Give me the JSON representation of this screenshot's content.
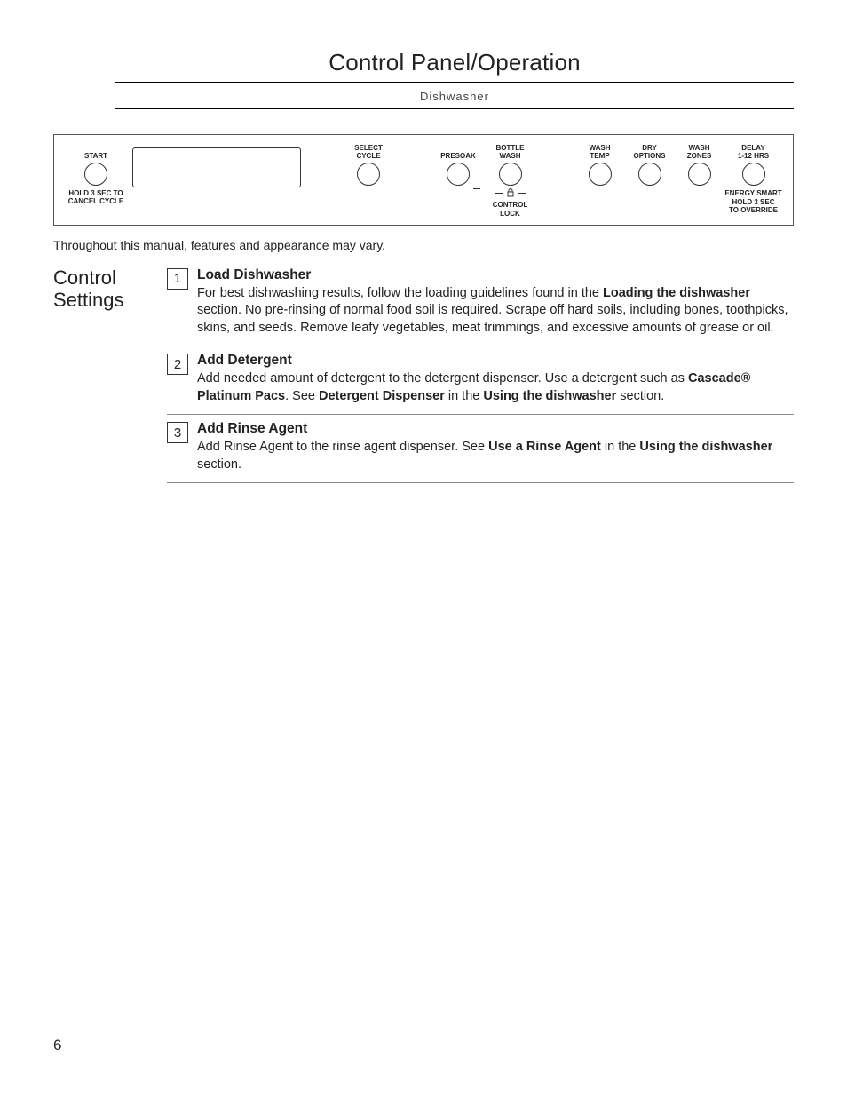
{
  "header": {
    "title": "Control Panel/Operation",
    "subtitle": "Dishwasher"
  },
  "panel": {
    "start": {
      "top": "START",
      "bottom1": "HOLD 3 SEC TO",
      "bottom2": "CANCEL CYCLE"
    },
    "select_cycle": {
      "top1": "SELECT",
      "top2": "CYCLE"
    },
    "presoak": {
      "top": "PRESOAK"
    },
    "bottle_wash": {
      "top1": "BOTTLE",
      "top2": "WASH",
      "lock1": "CONTROL",
      "lock2": "LOCK"
    },
    "wash_temp": {
      "top1": "WASH",
      "top2": "TEMP"
    },
    "dry_options": {
      "top1": "DRY",
      "top2": "OPTIONS"
    },
    "wash_zones": {
      "top1": "WASH",
      "top2": "ZONES"
    },
    "delay": {
      "top1": "DELAY",
      "top2": "1-12 HRS",
      "bottom1": "ENERGY SMART",
      "bottom2": "HOLD 3 SEC",
      "bottom3": "TO OVERRIDE"
    }
  },
  "note": "Throughout this manual, features and appearance may vary.",
  "side_label": "Control Settings",
  "steps": [
    {
      "num": "1",
      "title": "Load Dishwasher",
      "body_pre": "For best dishwashing results, follow the loading guidelines found in the ",
      "body_bold1": "Loading the dishwasher",
      "body_post": " section. No pre-rinsing of normal food soil is required. Scrape off hard soils, including bones, toothpicks, skins, and seeds. Remove leafy vegetables, meat trimmings, and excessive amounts of grease or oil."
    },
    {
      "num": "2",
      "title": "Add Detergent",
      "body_pre": "Add needed amount of detergent to the detergent dispenser. Use a detergent such as ",
      "body_bold1": "Cascade® Platinum Pacs",
      "body_mid1": ". See ",
      "body_bold2": "Detergent Dispenser",
      "body_mid2": " in the ",
      "body_bold3": "Using the dishwasher",
      "body_post": " section."
    },
    {
      "num": "3",
      "title": "Add Rinse Agent",
      "body_pre": "Add Rinse Agent to the rinse agent dispenser. See ",
      "body_bold1": "Use a Rinse Agent",
      "body_mid1": " in the ",
      "body_bold2": "Using the dishwasher",
      "body_post": " section."
    }
  ],
  "page_number": "6"
}
